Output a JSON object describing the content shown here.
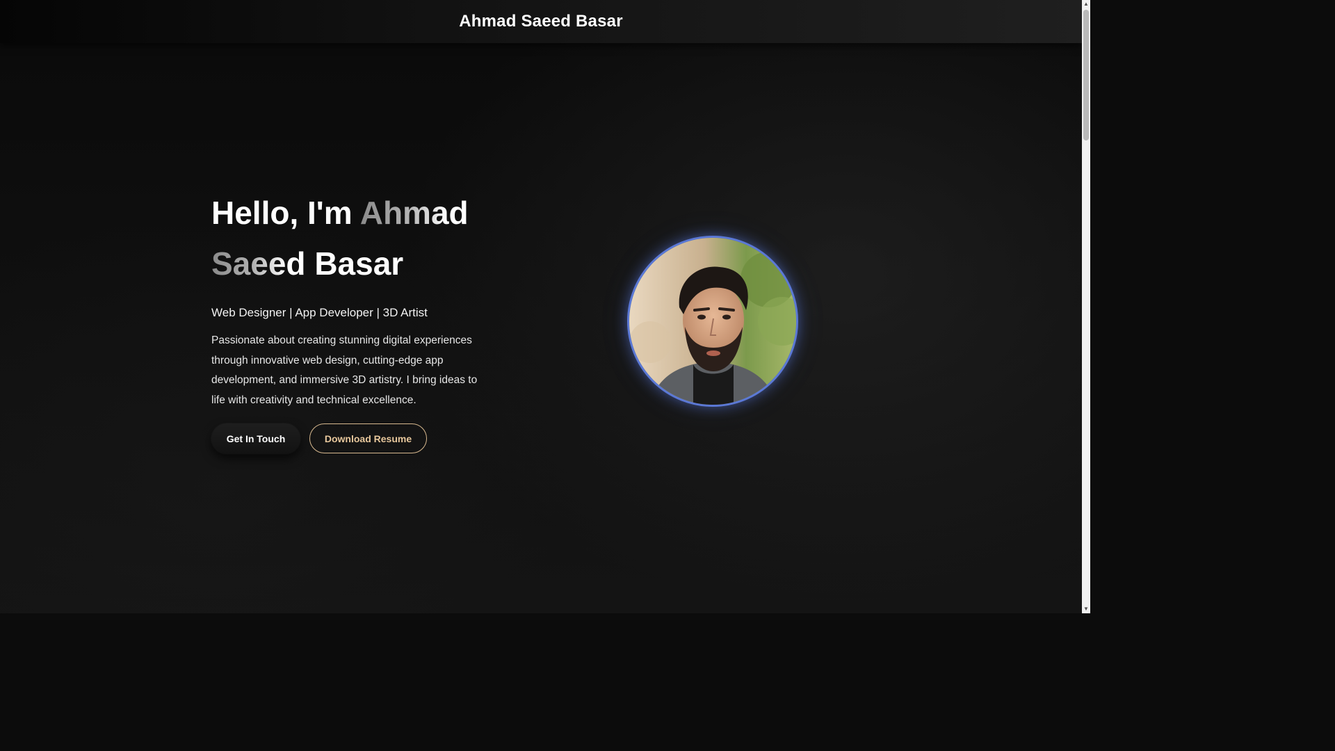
{
  "header": {
    "title": "Ahmad Saeed Basar"
  },
  "hero": {
    "greeting": "Hello, I'm",
    "name_line1": "Ahmad",
    "name_line2_part1": "Saeed",
    "name_line2_part2": "Basar",
    "roles": "Web Designer | App Developer | 3D Artist",
    "description": "Passionate about creating stunning digital experiences through innovative web design, cutting-edge app development, and immersive 3D artistry. I bring ideas to life with creativity and technical excellence."
  },
  "buttons": {
    "contact_label": "Get In Touch",
    "resume_label": "Download Resume"
  },
  "colors": {
    "background": "#0c0c0c",
    "text": "#ffffff",
    "outline_accent": "#d8b98f",
    "avatar_ring": "#5b78d6"
  },
  "icons": {
    "scroll_up": "triangle-up",
    "scroll_down": "triangle-down"
  }
}
